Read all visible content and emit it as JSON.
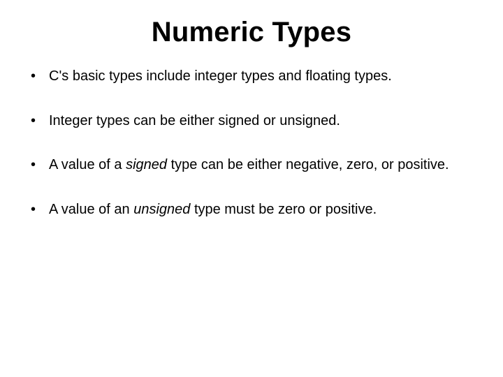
{
  "title": "Numeric Types",
  "bullets": [
    {
      "pre": "C's basic types include integer types and floating types.",
      "em": "",
      "post": ""
    },
    {
      "pre": "Integer types can be either signed or unsigned.",
      "em": "",
      "post": ""
    },
    {
      "pre": "A value of a ",
      "em": "signed",
      "post": " type can be either negative, zero, or positive."
    },
    {
      "pre": "A value of an ",
      "em": "unsigned",
      "post": " type must be zero or positive."
    }
  ]
}
